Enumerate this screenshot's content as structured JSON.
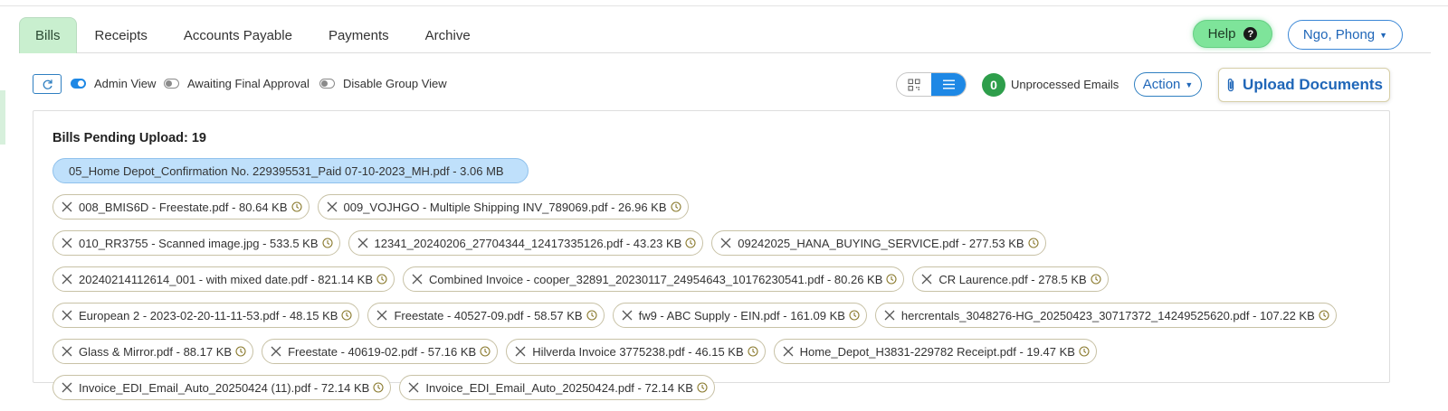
{
  "tabs": [
    {
      "label": "Bills"
    },
    {
      "label": "Receipts"
    },
    {
      "label": "Accounts Payable"
    },
    {
      "label": "Payments"
    },
    {
      "label": "Archive"
    }
  ],
  "header": {
    "help_label": "Help",
    "help_icon": "?",
    "user_name": "Ngo, Phong"
  },
  "toolbar": {
    "toggles": [
      {
        "label": "Admin View",
        "on": true
      },
      {
        "label": "Awaiting Final Approval",
        "on": false
      },
      {
        "label": "Disable Group View",
        "on": false
      }
    ],
    "view_mode": "list",
    "unprocessed_count": "0",
    "unprocessed_label": "Unprocessed Emails",
    "action_label": "Action",
    "upload_label": "Upload Documents"
  },
  "colors": {
    "accent_blue": "#1e88e5",
    "active_tab_green": "#c9efcf",
    "help_green": "#7ee49a",
    "badge_green": "#2e9e4b",
    "highlight_chip": "#bfe0fb"
  },
  "pending": {
    "title": "Bills Pending Upload: 19",
    "rows": [
      [
        {
          "label": "05_Home Depot_Confirmation No. 229395531_Paid 07-10-2023_MH.pdf - 3.06 MB",
          "highlighted": true
        }
      ],
      [
        {
          "label": "008_BMIS6D - Freestate.pdf - 80.64 KB"
        },
        {
          "label": "009_VOJHGO - Multiple Shipping INV_789069.pdf - 26.96 KB"
        }
      ],
      [
        {
          "label": "010_RR3755 - Scanned image.jpg - 533.5 KB"
        },
        {
          "label": "12341_20240206_27704344_12417335126.pdf - 43.23 KB"
        },
        {
          "label": "09242025_HANA_BUYING_SERVICE.pdf - 277.53 KB"
        }
      ],
      [
        {
          "label": "20240214112614_001 - with mixed date.pdf - 821.14 KB"
        },
        {
          "label": "Combined Invoice - cooper_32891_20230117_24954643_10176230541.pdf - 80.26 KB"
        },
        {
          "label": "CR Laurence.pdf - 278.5 KB"
        }
      ],
      [
        {
          "label": "European 2 - 2023-02-20-11-11-53.pdf - 48.15 KB"
        },
        {
          "label": "Freestate - 40527-09.pdf - 58.57 KB"
        },
        {
          "label": "fw9 - ABC Supply - EIN.pdf - 161.09 KB"
        },
        {
          "label": "hercrentals_3048276-HG_20250423_30717372_14249525620.pdf - 107.22 KB"
        }
      ],
      [
        {
          "label": "Glass & Mirror.pdf - 88.17 KB"
        },
        {
          "label": "Freestate - 40619-02.pdf - 57.16 KB"
        },
        {
          "label": "Hilverda Invoice 3775238.pdf - 46.15 KB"
        },
        {
          "label": "Home_Depot_H3831-229782 Receipt.pdf - 19.47 KB"
        }
      ],
      [
        {
          "label": "Invoice_EDI_Email_Auto_20250424 (11).pdf - 72.14 KB"
        },
        {
          "label": "Invoice_EDI_Email_Auto_20250424.pdf - 72.14 KB"
        }
      ]
    ]
  }
}
